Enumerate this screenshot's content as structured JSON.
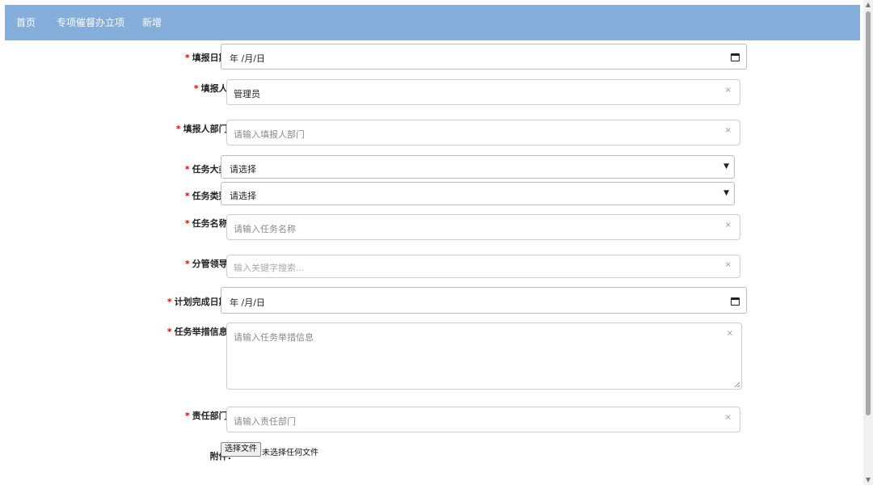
{
  "nav": {
    "items": [
      "首页",
      "专项催督办立项",
      "新增"
    ]
  },
  "form": {
    "report_date": {
      "label": "填报日期:",
      "value": "年 /月/日"
    },
    "reporter": {
      "label": "填报人:",
      "value": "管理员",
      "clear": "×"
    },
    "reporter_dept": {
      "label": "填报人部门:",
      "placeholder": "请输入填报人部门",
      "clear": "×"
    },
    "task_category": {
      "label": "任务大类:",
      "value": "请选择"
    },
    "task_type": {
      "label": "任务类别:",
      "value": "请选择"
    },
    "task_name": {
      "label": "任务名称:",
      "placeholder": "请输入任务名称",
      "clear": "×"
    },
    "leader": {
      "label": "分管领导:",
      "placeholder": "输入关键字搜索...",
      "clear": "×"
    },
    "plan_date": {
      "label": "计划完成日期:",
      "value": "年 /月/日"
    },
    "measures": {
      "label": "任务举措信息:",
      "placeholder": "请输入任务举措信息",
      "clear": "×"
    },
    "resp_dept": {
      "label": "责任部门:",
      "placeholder": "请输入责任部门",
      "clear": "×"
    },
    "attachment": {
      "label": "附件:",
      "button": "选择文件",
      "status": "未选择任何文件"
    },
    "required_mark": "*"
  }
}
